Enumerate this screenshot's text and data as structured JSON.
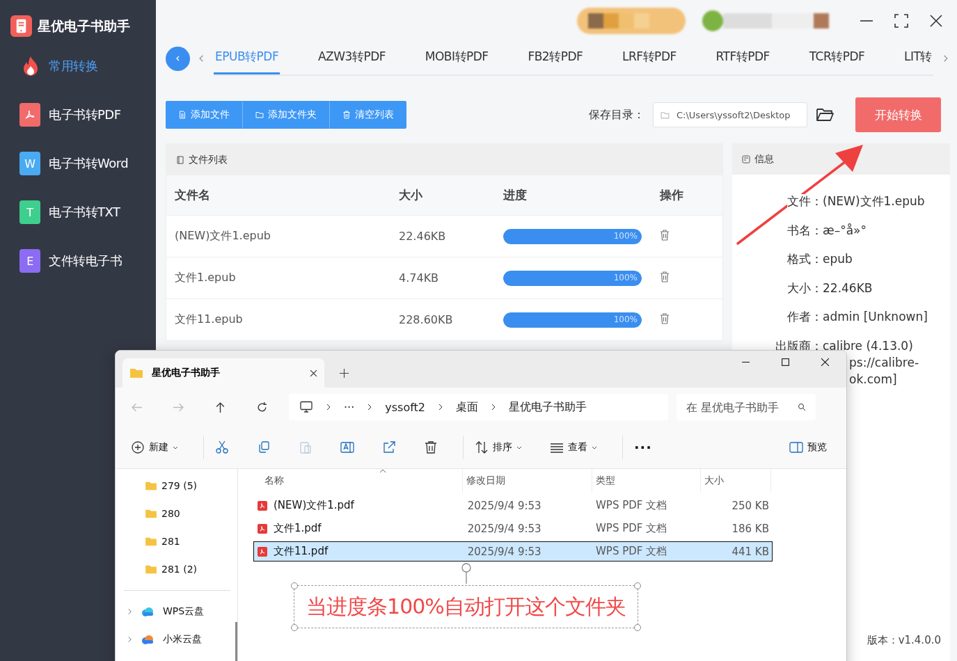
{
  "app": {
    "title": "星优电子书助手",
    "version": "版本：v1.4.0.0"
  },
  "sidebar": [
    {
      "label": "常用转换",
      "selected": true,
      "kind": "fire"
    },
    {
      "label": "电子书转PDF",
      "selected": false,
      "kind": "pdf",
      "color": "#f26b6b"
    },
    {
      "label": "电子书转Word",
      "selected": false,
      "kind": "letter",
      "letter": "W",
      "color": "#4aaaf2"
    },
    {
      "label": "电子书转TXT",
      "selected": false,
      "kind": "letter",
      "letter": "T",
      "color": "#3ecf8e"
    },
    {
      "label": "文件转电子书",
      "selected": false,
      "kind": "letter",
      "letter": "E",
      "color": "#8b6cf2"
    }
  ],
  "tabs": [
    {
      "label": "EPUB转PDF",
      "selected": true
    },
    {
      "label": "AZW3转PDF",
      "selected": false
    },
    {
      "label": "MOBI转PDF",
      "selected": false
    },
    {
      "label": "FB2转PDF",
      "selected": false
    },
    {
      "label": "LRF转PDF",
      "selected": false
    },
    {
      "label": "RTF转PDF",
      "selected": false
    },
    {
      "label": "TCR转PDF",
      "selected": false
    },
    {
      "label": "LIT转",
      "selected": false
    }
  ],
  "toolbar": [
    {
      "label": "添加文件",
      "kind": "file"
    },
    {
      "label": "添加文件夹",
      "kind": "folder"
    },
    {
      "label": "清空列表",
      "kind": "trash"
    }
  ],
  "save": {
    "label": "保存目录：",
    "path": "C:\\Users\\yssoft2\\Desktop",
    "start": "开始转换"
  },
  "file_list": {
    "title": "文件列表",
    "columns": [
      "文件名",
      "大小",
      "进度",
      "操作"
    ],
    "rows": [
      {
        "name": "(NEW)文件1.epub",
        "size": "22.46KB",
        "level": 1,
        "reading": "100%"
      },
      {
        "name": "文件1.epub",
        "size": "4.74KB",
        "level": 1,
        "reading": "100%"
      },
      {
        "name": "文件11.epub",
        "size": "228.60KB",
        "level": 1,
        "reading": "100%"
      }
    ]
  },
  "info": {
    "title": "信息",
    "fields": [
      {
        "label": "文件：",
        "lines": [
          "(NEW)文件1.epub"
        ]
      },
      {
        "label": "书名：",
        "lines": [
          "æ–°å»°"
        ]
      },
      {
        "label": "格式：",
        "lines": [
          "epub"
        ]
      },
      {
        "label": "大小：",
        "lines": [
          "22.46KB"
        ]
      },
      {
        "label": "作者：",
        "lines": [
          "admin [Unknown]"
        ]
      },
      {
        "label": "出版商：",
        "lines": [
          "calibre (4.13.0)",
          "ps://calibre-",
          "ok.com]"
        ]
      }
    ]
  },
  "explorer": {
    "tab": "星优电子书助手",
    "crumbs": [
      "···",
      "yssoft2",
      "桌面",
      "星优电子书助手"
    ],
    "search": {
      "placeholder": "在 星优电子书助手"
    },
    "commands": [
      {
        "kind": "new",
        "label": "新建",
        "disabled": false
      },
      {
        "kind": "cut",
        "disabled": false
      },
      {
        "kind": "copy",
        "disabled": false
      },
      {
        "kind": "paste",
        "disabled": true
      },
      {
        "kind": "rename",
        "disabled": false
      },
      {
        "kind": "share",
        "disabled": false
      },
      {
        "kind": "delete",
        "disabled": false
      },
      {
        "kind": "sort",
        "label": "排序",
        "disabled": false
      },
      {
        "kind": "view",
        "label": "查看",
        "disabled": false
      },
      {
        "kind": "more",
        "label": "···",
        "disabled": false
      }
    ],
    "preview": "预览",
    "folders": [
      "279 (5)",
      "280",
      "281",
      "281 (2)"
    ],
    "drives": [
      {
        "label": "WPS云盘",
        "kind": "wps"
      },
      {
        "label": "小米云盘",
        "kind": "mi"
      }
    ],
    "columns": [
      "名称",
      "修改日期",
      "类型",
      "大小"
    ],
    "files": [
      {
        "name": "(NEW)文件1.pdf",
        "date": "2025/9/4 9:53",
        "type": "WPS PDF 文档",
        "size": "250 KB",
        "selected": false
      },
      {
        "name": "文件1.pdf",
        "date": "2025/9/4 9:53",
        "type": "WPS PDF 文档",
        "size": "186 KB",
        "selected": false
      },
      {
        "name": "文件11.pdf",
        "date": "2025/9/4 9:53",
        "type": "WPS PDF 文档",
        "size": "441 KB",
        "selected": true
      }
    ]
  },
  "callout": "当进度条100%自动打开这个文件夹"
}
